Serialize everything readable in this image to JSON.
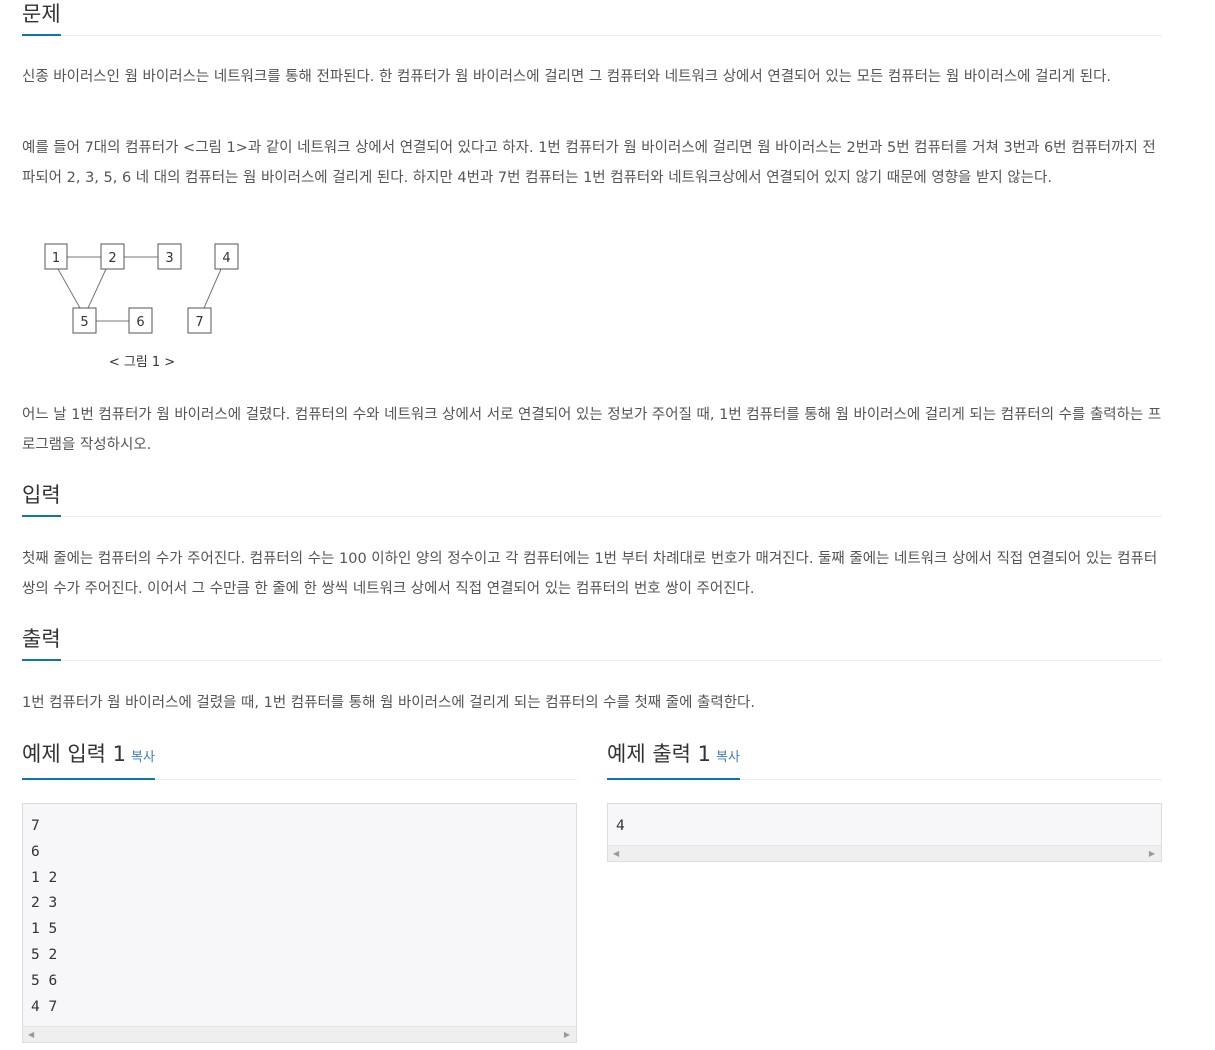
{
  "sections": {
    "problem": {
      "title": "문제",
      "p1": "신종 바이러스인 웜 바이러스는 네트워크를 통해 전파된다. 한 컴퓨터가 웜 바이러스에 걸리면 그 컴퓨터와 네트워크 상에서 연결되어 있는 모든 컴퓨터는 웜 바이러스에 걸리게 된다.",
      "p2": "예를 들어 7대의 컴퓨터가 <그림 1>과 같이 네트워크 상에서 연결되어 있다고 하자. 1번 컴퓨터가 웜 바이러스에 걸리면 웜 바이러스는 2번과 5번 컴퓨터를 거쳐 3번과 6번 컴퓨터까지 전파되어 2, 3, 5, 6 네 대의 컴퓨터는 웜 바이러스에 걸리게 된다. 하지만 4번과 7번 컴퓨터는 1번 컴퓨터와 네트워크상에서 연결되어 있지 않기 때문에 영향을 받지 않는다.",
      "p3": "어느 날 1번 컴퓨터가 웜 바이러스에 걸렸다. 컴퓨터의 수와 네트워크 상에서 서로 연결되어 있는 정보가 주어질 때, 1번 컴퓨터를 통해 웜 바이러스에 걸리게 되는 컴퓨터의 수를 출력하는 프로그램을 작성하시오."
    },
    "input": {
      "title": "입력",
      "p1": "첫째 줄에는 컴퓨터의 수가 주어진다. 컴퓨터의 수는 100 이하인 양의 정수이고 각 컴퓨터에는 1번 부터 차례대로 번호가 매겨진다. 둘째 줄에는 네트워크 상에서 직접 연결되어 있는 컴퓨터 쌍의 수가 주어진다. 이어서 그 수만큼 한 줄에 한 쌍씩 네트워크 상에서 직접 연결되어 있는 컴퓨터의 번호 쌍이 주어진다."
    },
    "output": {
      "title": "출력",
      "p1": "1번 컴퓨터가 웜 바이러스에 걸렸을 때, 1번 컴퓨터를 통해 웜 바이러스에 걸리게 되는 컴퓨터의 수를 첫째 줄에 출력한다."
    }
  },
  "figure": {
    "caption": "< 그림 1 >",
    "nodes": [
      "1",
      "2",
      "3",
      "4",
      "5",
      "6",
      "7"
    ]
  },
  "samples": {
    "input": {
      "title": "예제 입력 1",
      "copy_label": "복사",
      "content": "7\n6\n1 2\n2 3\n1 5\n5 2\n5 6\n4 7"
    },
    "output": {
      "title": "예제 출력 1",
      "copy_label": "복사",
      "content": "4"
    }
  }
}
